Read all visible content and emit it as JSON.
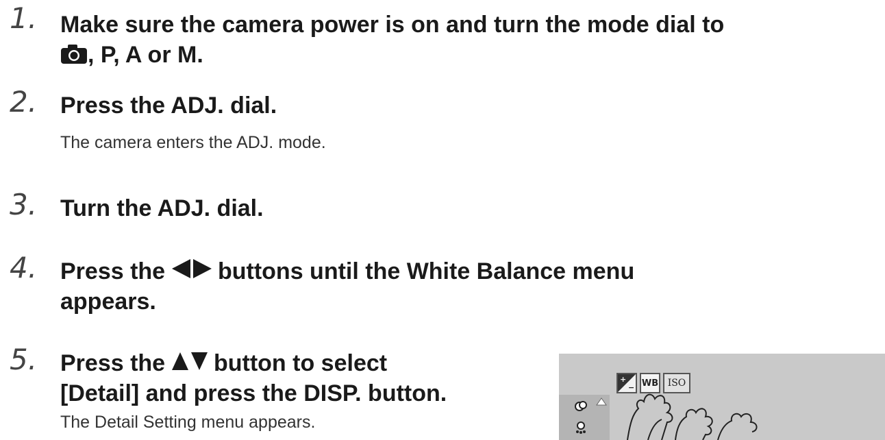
{
  "steps": [
    {
      "num": "1.",
      "title_line1": "Make sure the camera power is on and turn the mode dial to",
      "title_line2": ", P, A or M."
    },
    {
      "num": "2.",
      "title": "Press the ADJ. dial.",
      "body": "The camera enters the ADJ. mode."
    },
    {
      "num": "3.",
      "title": "Turn the ADJ. dial."
    },
    {
      "num": "4.",
      "title_pre": "Press the ",
      "title_post": " buttons until the White Balance menu",
      "title_line2": "appears."
    },
    {
      "num": "5.",
      "title_pre": "Press the ",
      "title_post": " button to select",
      "title_line2": "[Detail] and press the DISP. button.",
      "body": "The Detail Setting menu appears."
    }
  ],
  "screen": {
    "toolbar": {
      "wb_label": "WB",
      "iso_label": "ISO"
    }
  },
  "icons": {
    "camera_mode": "camera-icon",
    "left_right": "left-right-arrow-icon",
    "up_down": "up-down-arrow-icon"
  }
}
